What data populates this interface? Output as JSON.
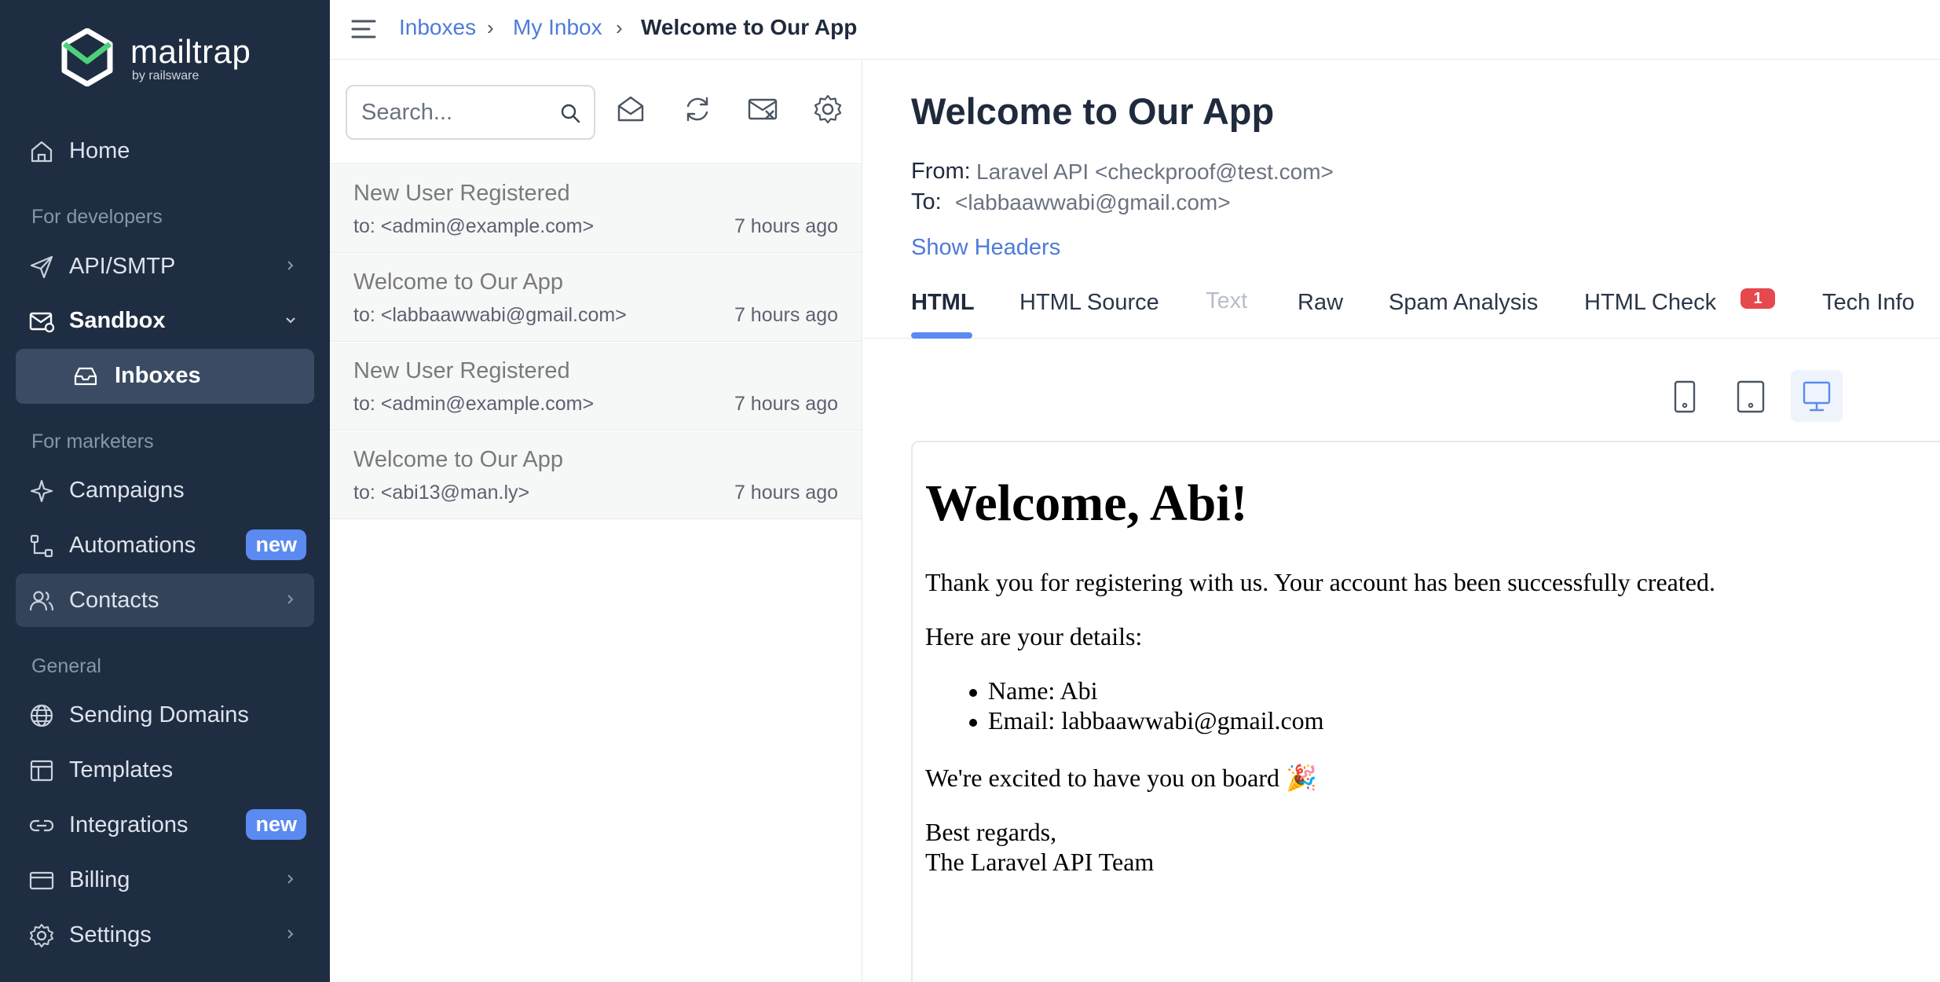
{
  "brand": {
    "name": "mailtrap",
    "tagline": "by railsware",
    "accent": "#5b8af0"
  },
  "sidebar": {
    "items": [
      {
        "label": "Home"
      },
      {
        "label": "API/SMTP"
      },
      {
        "label": "Sandbox"
      },
      {
        "label": "Inboxes"
      },
      {
        "label": "Campaigns"
      },
      {
        "label": "Automations",
        "badge": "new"
      },
      {
        "label": "Contacts"
      },
      {
        "label": "Sending Domains"
      },
      {
        "label": "Templates"
      },
      {
        "label": "Integrations",
        "badge": "new"
      },
      {
        "label": "Billing"
      },
      {
        "label": "Settings"
      }
    ],
    "sections": [
      "For developers",
      "For marketers",
      "General"
    ]
  },
  "breadcrumb": {
    "items": [
      "Inboxes",
      "My Inbox",
      "Welcome to Our App"
    ],
    "separator": "›"
  },
  "search": {
    "placeholder": "Search..."
  },
  "messages": [
    {
      "subject": "New User Registered",
      "to": "to: <admin@example.com>",
      "time": "7 hours ago"
    },
    {
      "subject": "Welcome to Our App",
      "to": "to: <labbaawwabi@gmail.com>",
      "time": "7 hours ago"
    },
    {
      "subject": "New User Registered",
      "to": "to: <admin@example.com>",
      "time": "7 hours ago"
    },
    {
      "subject": "Welcome to Our App",
      "to": "to: <abi13@man.ly>",
      "time": "7 hours ago"
    }
  ],
  "view": {
    "title": "Welcome to Our App",
    "from_label": "From:",
    "from_value": "Laravel API <checkproof@test.com>",
    "to_label": "To:",
    "to_value": "<labbaawwabi@gmail.com>",
    "show_headers": "Show Headers",
    "tabs": [
      {
        "label": "HTML",
        "state": "active"
      },
      {
        "label": "HTML Source"
      },
      {
        "label": "Text",
        "state": "disabled"
      },
      {
        "label": "Raw"
      },
      {
        "label": "Spam Analysis"
      },
      {
        "label": "HTML Check",
        "badge": "1"
      },
      {
        "label": "Tech Info"
      }
    ]
  },
  "email_body": {
    "heading": "Welcome, Abi!",
    "intro": "Thank you for registering with us. Your account has been successfully created.",
    "details_heading": "Here are your details:",
    "details": [
      "Name: Abi",
      "Email: labbaawwabi@gmail.com"
    ],
    "excited": "We're excited to have you on board 🎉",
    "signoff": "Best regards,",
    "signature": "The Laravel API Team"
  }
}
